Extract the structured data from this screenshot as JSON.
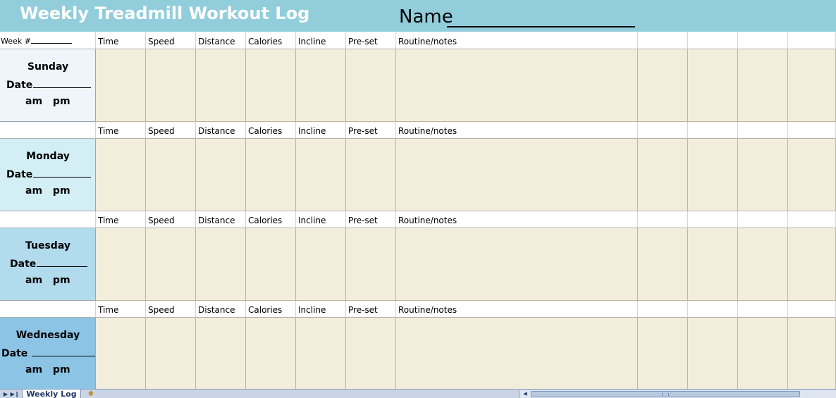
{
  "title": "Weekly Treadmill Workout Log",
  "name_label": "Name",
  "week_label": "Week #",
  "columns": [
    "Time",
    "Speed",
    "Distance",
    "Calories",
    "Incline",
    "Pre-set",
    "Routine/notes"
  ],
  "days": [
    {
      "name": "Sunday",
      "date_label": "Date",
      "am": "am",
      "pm": "pm",
      "color": "#eef5fb"
    },
    {
      "name": "Monday",
      "date_label": "Date",
      "am": "am",
      "pm": "pm",
      "color": "#d4eef5"
    },
    {
      "name": "Tuesday",
      "date_label": "Date",
      "am": "am",
      "pm": "pm",
      "color": "#b2dbee"
    },
    {
      "name": "Wednesday",
      "date_label": "Date ",
      "am": "am",
      "pm": "pm",
      "color": "#8cc4e6"
    }
  ],
  "tab_bar": {
    "sheet_tab": "Weekly Log"
  },
  "colors": {
    "title_band": "#92cddc",
    "grid_fill": "#f3eddc"
  }
}
